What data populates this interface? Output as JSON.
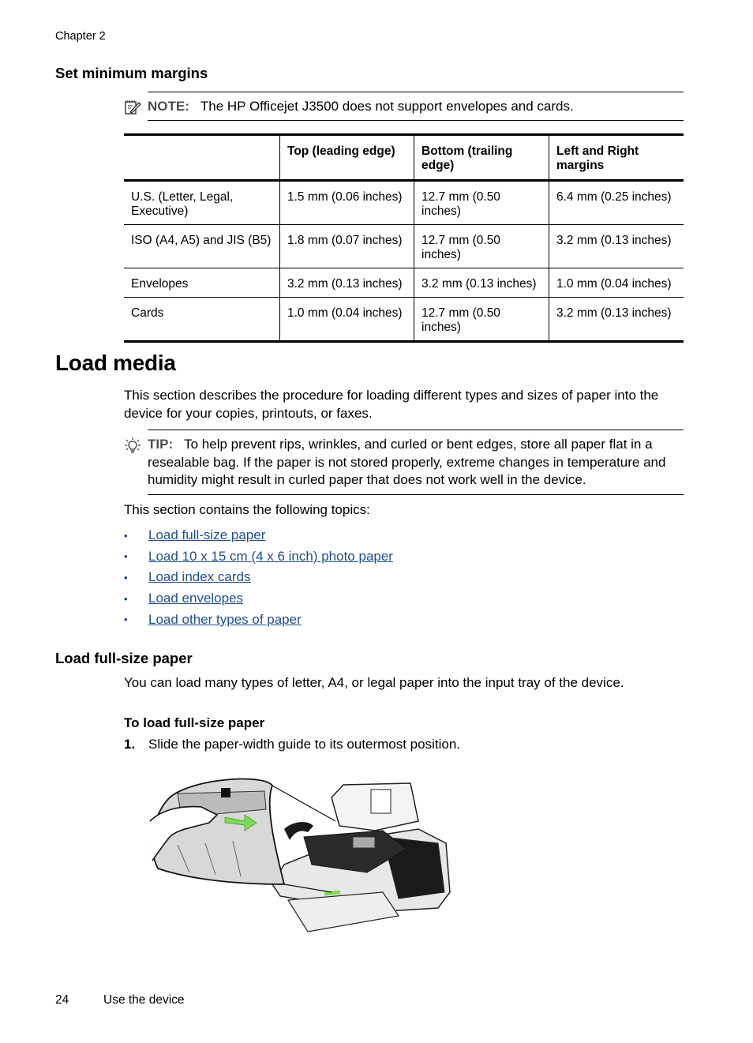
{
  "header": {
    "chapter": "Chapter 2"
  },
  "section_margins": {
    "title": "Set minimum margins",
    "note": {
      "icon": "note-pencil-icon",
      "label": "NOTE:",
      "text": "The HP Officejet J3500 does not support envelopes and cards."
    },
    "table": {
      "headers": [
        "",
        "Top (leading edge)",
        "Bottom (trailing edge)",
        "Left and Right margins"
      ],
      "rows": [
        [
          "U.S. (Letter, Legal, Executive)",
          "1.5 mm (0.06 inches)",
          "12.7 mm (0.50 inches)",
          "6.4 mm (0.25 inches)"
        ],
        [
          "ISO (A4, A5) and JIS (B5)",
          "1.8 mm (0.07 inches)",
          "12.7 mm (0.50 inches)",
          "3.2 mm (0.13 inches)"
        ],
        [
          "Envelopes",
          "3.2 mm (0.13 inches)",
          "3.2 mm (0.13 inches)",
          "1.0 mm (0.04 inches)"
        ],
        [
          "Cards",
          "1.0 mm (0.04 inches)",
          "12.7 mm (0.50 inches)",
          "3.2 mm (0.13 inches)"
        ]
      ]
    }
  },
  "section_load_media": {
    "title": "Load media",
    "intro": "This section describes the procedure for loading different types and sizes of paper into the device for your copies, printouts, or faxes.",
    "tip": {
      "icon": "lightbulb-icon",
      "label": "TIP:",
      "text": "To help prevent rips, wrinkles, and curled or bent edges, store all paper flat in a resealable bag. If the paper is not stored properly, extreme changes in temperature and humidity might result in curled paper that does not work well in the device."
    },
    "topics_intro": "This section contains the following topics:",
    "topics": [
      "Load full-size paper",
      "Load 10 x 15 cm (4 x 6 inch) photo paper",
      "Load index cards",
      "Load envelopes",
      "Load other types of paper"
    ],
    "link_color": "#1f4e8c"
  },
  "section_full_size": {
    "title": "Load full-size paper",
    "intro": "You can load many types of letter, A4, or legal paper into the input tray of the device.",
    "procedure_title": "To load full-size paper",
    "steps": [
      {
        "number": "1.",
        "text": "Slide the paper-width guide to its outermost position."
      }
    ],
    "figure": {
      "description": "Printer illustration with magnified inset of hand sliding the paper-width guide outward (green arrow)",
      "arrow_color": "#7ed957"
    }
  },
  "footer": {
    "page_number": "24",
    "section": "Use the device"
  }
}
